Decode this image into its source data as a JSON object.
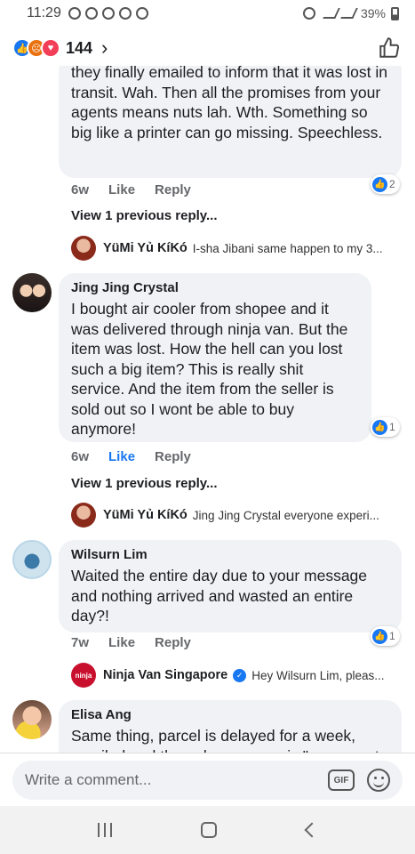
{
  "status_bar": {
    "time": "11:29",
    "battery": "39%"
  },
  "reactions": {
    "count": "144",
    "icons": [
      "like-icon",
      "angry-icon",
      "love-icon"
    ]
  },
  "comments": [
    {
      "text": "they finally emailed to inform that it was lost in transit. Wah. Then all the promises from your agents means nuts lah. Wth. Something so big like a printer can go missing. Speechless.",
      "age": "6w",
      "like_label": "Like",
      "reply_label": "Reply",
      "like_count": "2",
      "view_prev": "View 1 previous reply...",
      "reply_preview": {
        "name": "YüMi Yủ KíKó",
        "text": "I-sha Jibani same happen to my 3..."
      }
    },
    {
      "name": "Jing Jing Crystal",
      "text": "I bought air cooler from shopee and it was delivered through ninja van. But the item was lost. How the hell can you lost such a big item? This is really shit service. And the item from the seller is sold out so I wont be able to buy anymore!",
      "age": "6w",
      "like_label": "Like",
      "reply_label": "Reply",
      "like_count": "1",
      "view_prev": "View 1 previous reply...",
      "reply_preview": {
        "name": "YüMi Yủ KíKó",
        "text": "Jing Jing Crystal everyone experi..."
      }
    },
    {
      "name": "Wilsurn Lim",
      "text": "Waited the entire day due to your message and nothing arrived and wasted an entire day?!",
      "age": "7w",
      "like_label": "Like",
      "reply_label": "Reply",
      "like_count": "1",
      "reply_preview": {
        "name": "Ninja Van Singapore",
        "avatar_label": "ninja",
        "text": "Hey Wilsurn Lim, pleas..."
      }
    },
    {
      "name": "Elisa Ang",
      "text": "Same thing, parcel is delayed for a week, emailed and the only response is \"we cannot"
    }
  ],
  "composer": {
    "placeholder": "Write a comment...",
    "gif_label": "GIF"
  },
  "colors": {
    "accent": "#1877f2",
    "bubble": "#f0f2f5",
    "meta": "#65676b"
  }
}
